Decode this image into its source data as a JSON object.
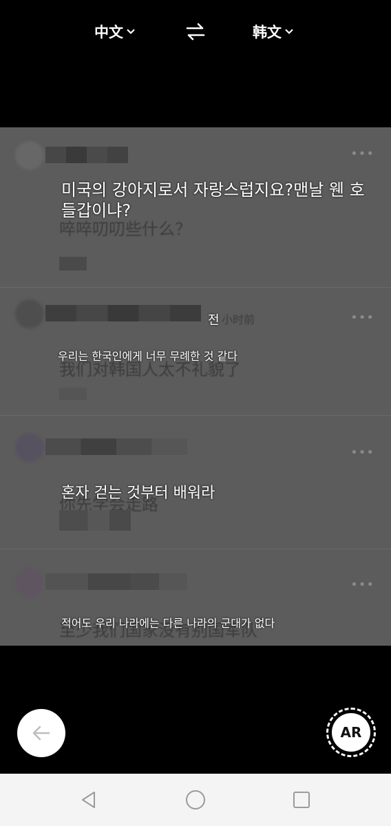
{
  "header": {
    "source_lang": "中文",
    "target_lang": "韩文"
  },
  "translations": {
    "post1": "미국의 강아지로서 자랑스럽지요?맨날 웬 호들갑이냐?",
    "post2_time": "전",
    "post2": "우리는 한국인에게 너무 무례한 것 같다",
    "post3": "혼자 걷는 것부터 배워라",
    "post4": "적어도 우리 나라에는 다른 나라의 군대가 없다"
  },
  "background_text": {
    "post1_line": "啐啐叨叨些什么？",
    "post2_time": "小时前",
    "post2_line": "我们对韩国人太不礼貌了",
    "post3_line": "你先学会走路",
    "post4_line": "至少我们国家没有别国军队"
  },
  "controls": {
    "ar_label": "AR"
  },
  "icons": {
    "source_lang_chevron": "chevron-down-icon",
    "target_lang_chevron": "chevron-down-icon",
    "swap": "swap-icon",
    "back": "arrow-left-icon",
    "ar": "ar-icon",
    "nav_back": "triangle-back-icon",
    "nav_home": "circle-home-icon",
    "nav_recent": "square-recents-icon"
  },
  "colors": {
    "background": "#000000",
    "overlay": "#5c5c5c",
    "text": "#ffffff",
    "nav_bar": "#f4f4f4"
  }
}
